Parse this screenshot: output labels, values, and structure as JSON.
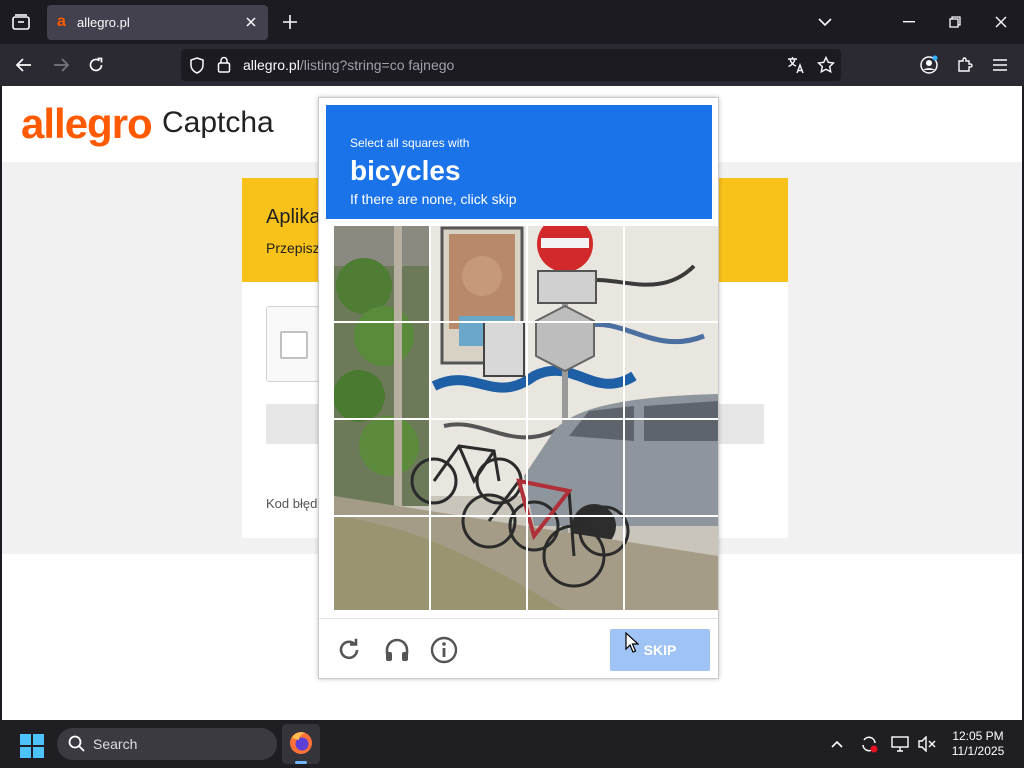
{
  "browser": {
    "tab_title": "allegro.pl",
    "favicon_letter": "a",
    "url_host": "allegro.pl",
    "url_path": "/listing?string=co fajnego"
  },
  "page": {
    "logo": "allegro",
    "heading": "Captcha",
    "card_title": "Aplika",
    "card_subtitle": "Przepisz",
    "error_code_label": "Kod błęd"
  },
  "challenge": {
    "instruction": "Select all squares with",
    "target": "bicycles",
    "hint": "If there are none, click skip",
    "skip_label": "SKIP",
    "grid_rows": 4,
    "grid_cols": 4
  },
  "taskbar": {
    "search_placeholder": "Search",
    "time": "12:05 PM",
    "date": "11/1/2025"
  },
  "colors": {
    "allegro_orange": "#ff5a00",
    "captcha_blue": "#1a73e8",
    "skip_disabled": "#9fc3f4",
    "card_header_yellow": "#f9c21b"
  }
}
